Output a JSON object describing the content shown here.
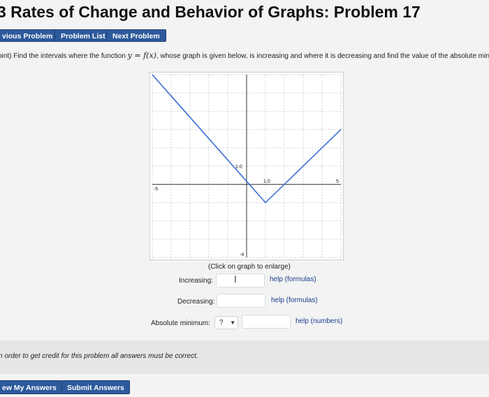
{
  "title": "3 Rates of Change and Behavior of Graphs: Problem 17",
  "nav": {
    "previous": "vious Problem",
    "list": "Problem List",
    "next": "Next Problem"
  },
  "problem": {
    "prefix": "oint) Find the intervals where the function ",
    "math": "y = f(x)",
    "suffix": ", whose graph is given below, is increasing and where it is decreasing and find the value of the absolute minim"
  },
  "graph": {
    "caption": "(Click on graph to enlarge)",
    "x_min_label": "-5",
    "x_max_label": "5",
    "y_tick_label": "1.0",
    "y_min_label": "-4",
    "point_label": "1.0",
    "line_color": "#3b6fd6",
    "data": {
      "xlim": [
        -5,
        5
      ],
      "ylim": [
        -4,
        6
      ],
      "points": [
        [
          -5,
          6
        ],
        [
          1,
          -1
        ],
        [
          5,
          3
        ]
      ]
    }
  },
  "form": {
    "increasing_label": "Increasing:",
    "decreasing_label": "Decreasing:",
    "absmin_label": "Absolute minimum:",
    "select_value": "?",
    "help_formulas": "help (formulas)",
    "help_numbers": "help (numbers)"
  },
  "note": "n order to get credit for this problem all answers must be correct.",
  "buttons": {
    "preview": "ew My Answers",
    "submit": "Submit Answers"
  }
}
